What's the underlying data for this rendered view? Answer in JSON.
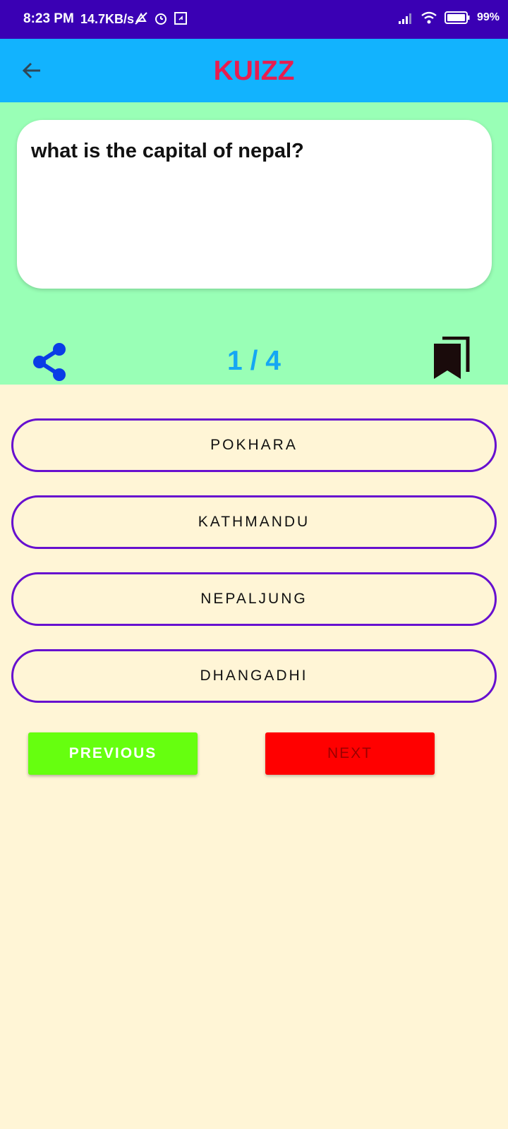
{
  "status_bar": {
    "time": "8:23 PM",
    "speed": "14.7KB/s",
    "battery": "99%",
    "icons": [
      "mute-icon",
      "alarm-icon",
      "notification-icon",
      "signal-icon",
      "wifi-icon",
      "battery-icon"
    ]
  },
  "app_bar": {
    "title": "KUIZZ",
    "back_icon": "arrow-back-icon",
    "title_color": "#e81d4f",
    "background": "#12b3fe"
  },
  "question": {
    "text": "what is the capital of nepal?",
    "counter": "1 / 4"
  },
  "options": [
    "POKHARA",
    "KATHMANDU",
    "NEPALJUNG",
    "DHANGADHI"
  ],
  "navigation": {
    "previous_label": "PREVIOUS",
    "next_label": "NEXT",
    "previous_color": "#66ff0f",
    "next_color": "#ff0000"
  },
  "colors": {
    "status_bar": "#3a00b4",
    "green_panel": "#99ffb6",
    "page_background": "#fff5d6",
    "option_border": "#6710cf",
    "share_icon": "#0a3de6",
    "bookmark_icon": "#1a0b0b"
  }
}
